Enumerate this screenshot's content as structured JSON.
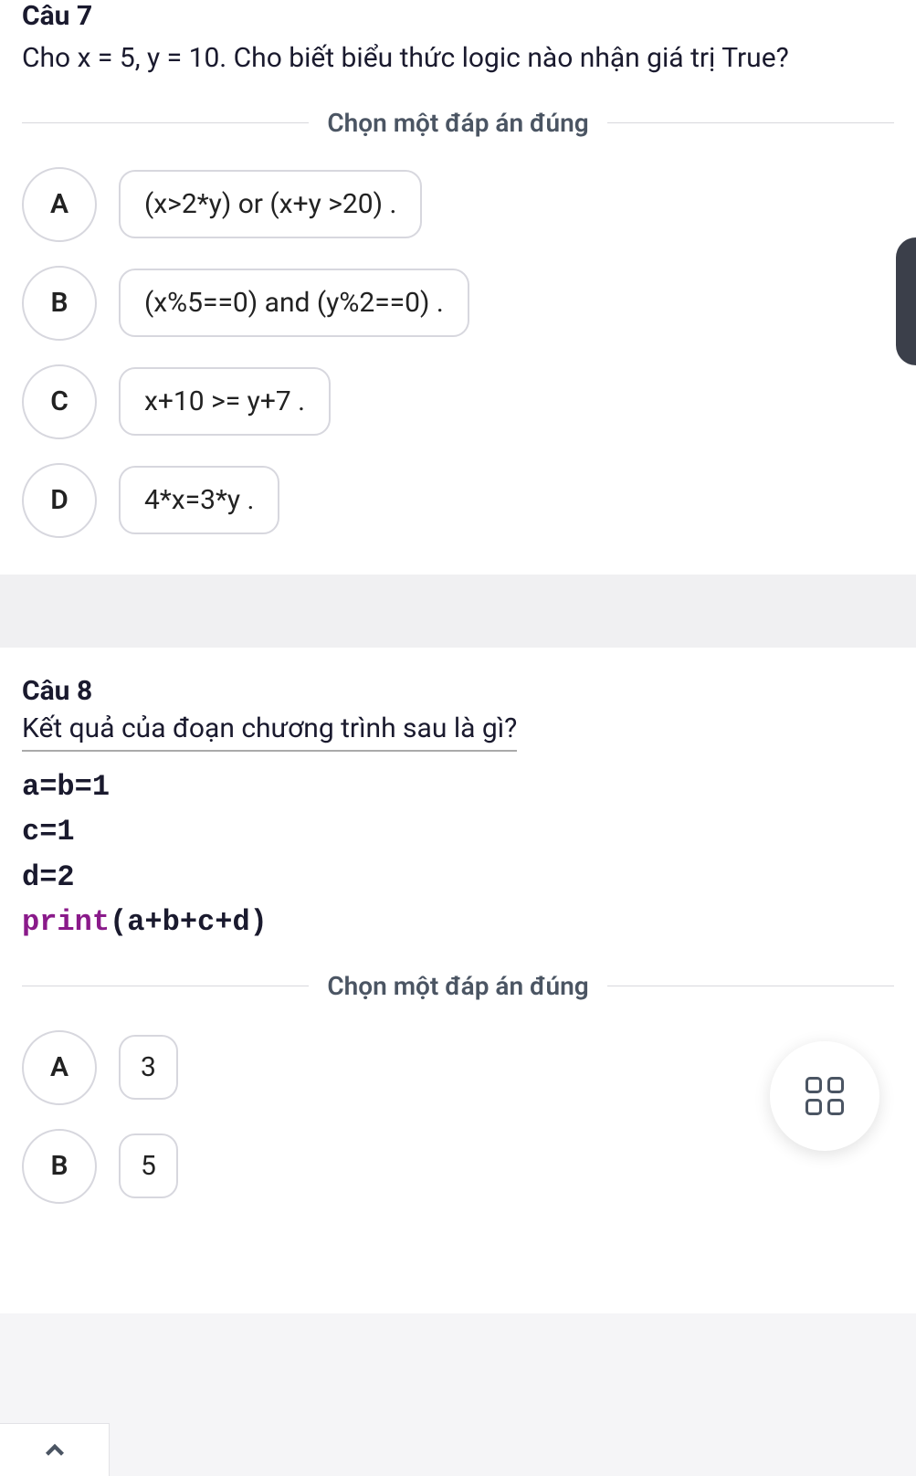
{
  "q7": {
    "title": "Câu 7",
    "text": "Cho x = 5, y = 10. Cho biết biểu thức logic nào nhận giá trị True?",
    "divider": "Chọn một đáp án đúng",
    "options": [
      {
        "letter": "A",
        "label": "(x>2*y) or (x+y >20) ."
      },
      {
        "letter": "B",
        "label": "(x%5==0) and (y%2==0) ."
      },
      {
        "letter": "C",
        "label": "x+10 >= y+7 ."
      },
      {
        "letter": "D",
        "label": "4*x=3*y ."
      }
    ]
  },
  "q8": {
    "title": "Câu 8",
    "subtitle": "Kết quả của đoạn chương trình sau là gì?",
    "code": {
      "l1": "a=b=1",
      "l2": "c=1",
      "l3": "d=2",
      "kw": "print",
      "args": "(a+b+c+d)"
    },
    "divider": "Chọn một đáp án đúng",
    "options": [
      {
        "letter": "A",
        "label": "3"
      },
      {
        "letter": "B",
        "label": "5"
      }
    ]
  }
}
